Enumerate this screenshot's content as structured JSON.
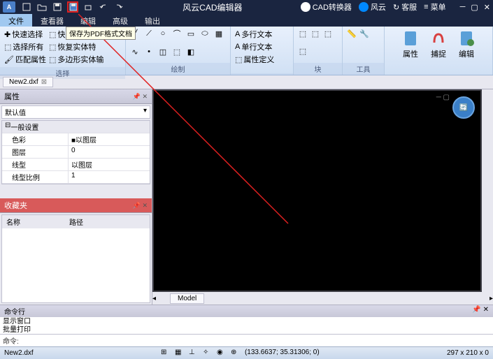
{
  "title": "风云CAD编辑器",
  "titlebar_buttons": {
    "cad_converter": "CAD转换器",
    "fengyun": "风云",
    "support": "客服",
    "menu": "菜单"
  },
  "menu_tabs": [
    "文件",
    "查看器",
    "编辑",
    "高级",
    "输出"
  ],
  "active_tab": 2,
  "tooltip_text": "保存为PDF格式文档",
  "ribbon": {
    "select": {
      "label": "选择",
      "items": [
        "快速选择",
        "选择所有",
        "匹配属性",
        "快速",
        "恢复实体特",
        "多边形实体输"
      ]
    },
    "draw": {
      "label": "绘制"
    },
    "text": {
      "items": [
        "多行文本",
        "单行文本",
        "属性定义"
      ]
    },
    "block": {
      "label": "块"
    },
    "tools": {
      "label": "工具"
    },
    "props": {
      "label": "属性"
    },
    "capture": {
      "label": "捕捉"
    },
    "edit": {
      "label": "编辑"
    }
  },
  "doc_tab": "New2.dxf",
  "panels": {
    "properties": {
      "title": "属性",
      "dropdown": "默认值",
      "section": "一般设置",
      "rows": [
        {
          "key": "色彩",
          "val": "■以图层"
        },
        {
          "key": "图层",
          "val": "0"
        },
        {
          "key": "线型",
          "val": "以图层"
        },
        {
          "key": "线型比例",
          "val": "1"
        }
      ]
    },
    "favorites": {
      "title": "收藏夹",
      "cols": [
        "名称",
        "路径"
      ]
    }
  },
  "model_tab": "Model",
  "cmdline": {
    "title": "命令行",
    "history": [
      "显示窗口",
      "批量打印"
    ],
    "prompt": "命令:"
  },
  "status": {
    "file": "New2.dxf",
    "coords": "(133.6637; 35.31306; 0)",
    "dims": "297 x 210 x 0"
  }
}
